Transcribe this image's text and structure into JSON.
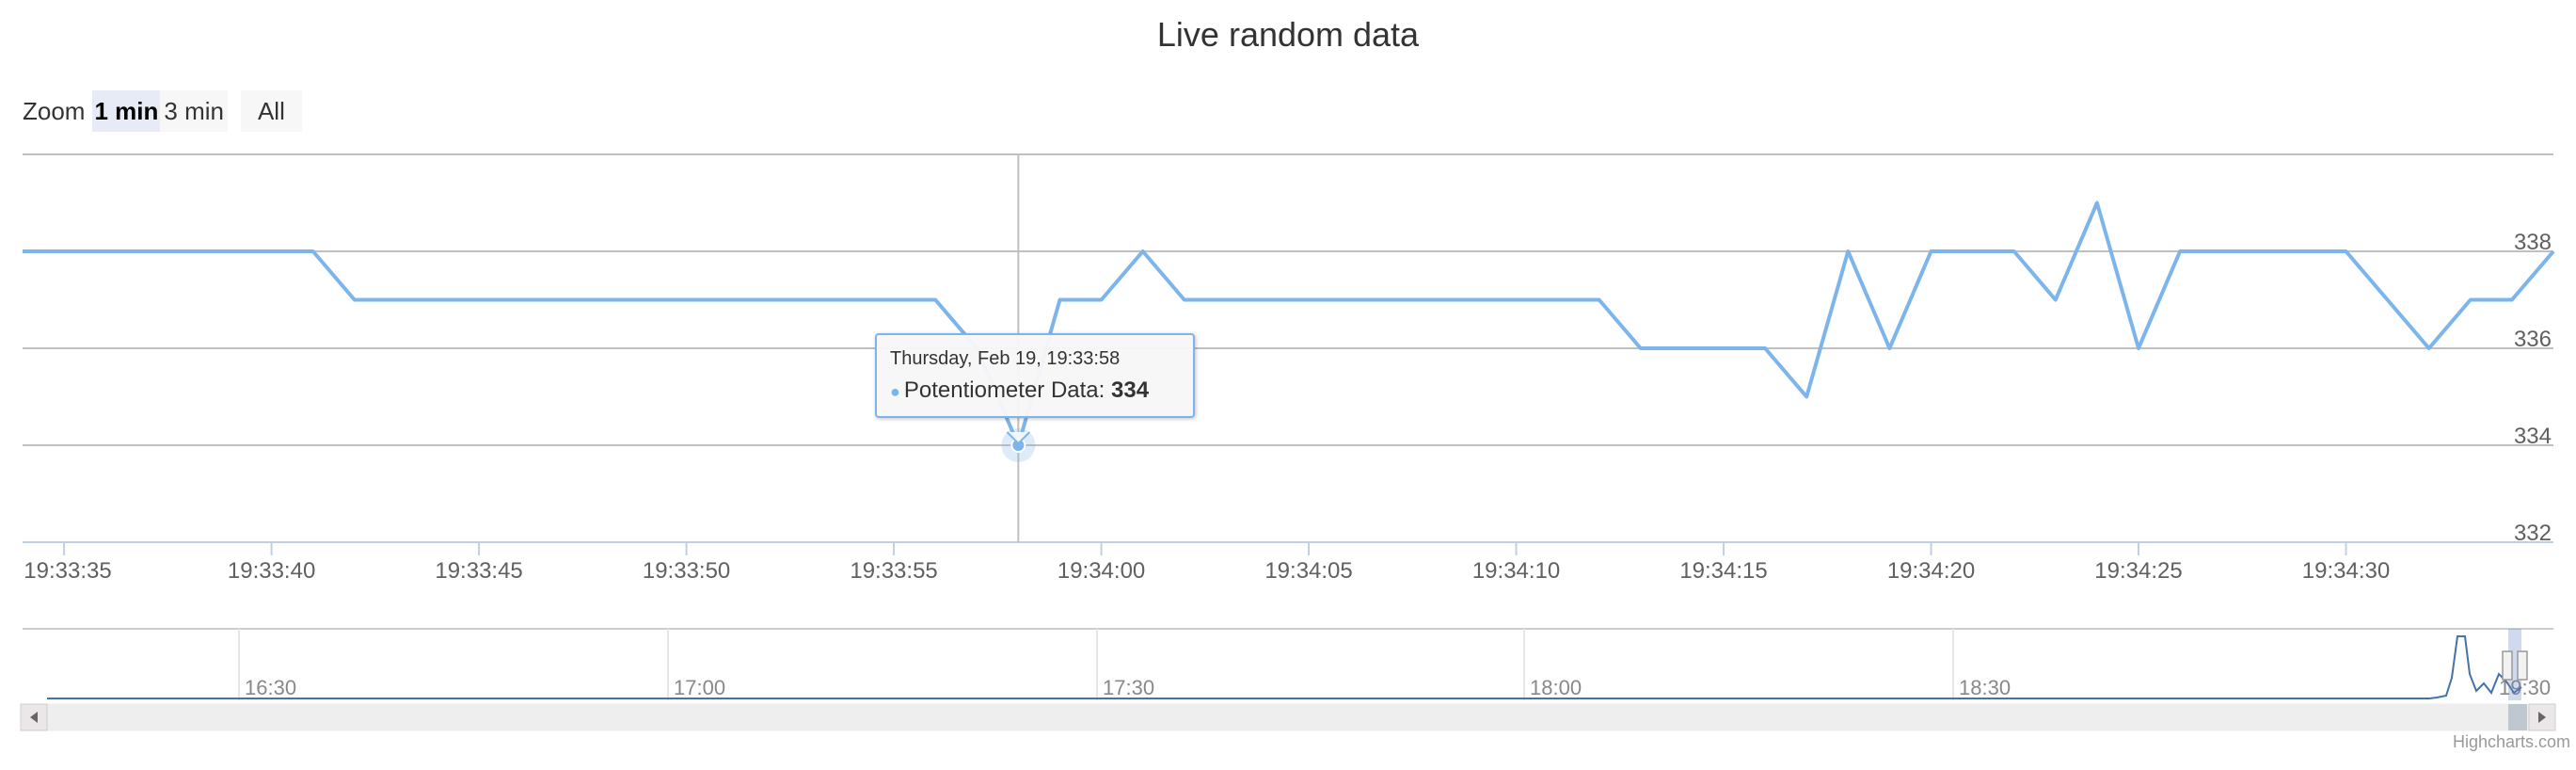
{
  "chart_data": {
    "type": "line",
    "title": "Live random data",
    "series": [
      {
        "name": "Potentiometer Data",
        "color": "#7cb5ec",
        "x": [
          "19:33:34",
          "19:33:35",
          "19:33:36",
          "19:33:37",
          "19:33:38",
          "19:33:39",
          "19:33:40",
          "19:33:41",
          "19:33:42",
          "19:33:43",
          "19:33:44",
          "19:33:45",
          "19:33:46",
          "19:33:47",
          "19:33:48",
          "19:33:49",
          "19:33:50",
          "19:33:51",
          "19:33:52",
          "19:33:53",
          "19:33:54",
          "19:33:55",
          "19:33:56",
          "19:33:57",
          "19:33:58",
          "19:33:59",
          "19:34:00",
          "19:34:01",
          "19:34:02",
          "19:34:03",
          "19:34:04",
          "19:34:05",
          "19:34:06",
          "19:34:07",
          "19:34:08",
          "19:34:09",
          "19:34:10",
          "19:34:11",
          "19:34:12",
          "19:34:13",
          "19:34:14",
          "19:34:15",
          "19:34:16",
          "19:34:17",
          "19:34:18",
          "19:34:19",
          "19:34:20",
          "19:34:21",
          "19:34:22",
          "19:34:23",
          "19:34:24",
          "19:34:25",
          "19:34:26",
          "19:34:27",
          "19:34:28",
          "19:34:29",
          "19:34:30",
          "19:34:31",
          "19:34:32",
          "19:34:33",
          "19:34:34",
          "19:34:35"
        ],
        "values": [
          338,
          338,
          338,
          338,
          338,
          338,
          338,
          338,
          337,
          337,
          337,
          337,
          337,
          337,
          337,
          337,
          337,
          337,
          337,
          337,
          337,
          337,
          337,
          336,
          334,
          337,
          337,
          338,
          337,
          337,
          337,
          337,
          337,
          337,
          337,
          337,
          337,
          337,
          337,
          336,
          336,
          336,
          336,
          335,
          338,
          336,
          338,
          338,
          338,
          337,
          339,
          336,
          338,
          338,
          338,
          338,
          338,
          337,
          336,
          337,
          337,
          338
        ]
      }
    ],
    "xlabel": "",
    "ylabel": "",
    "x_ticks": [
      "19:33:35",
      "19:33:40",
      "19:33:45",
      "19:33:50",
      "19:33:55",
      "19:34:00",
      "19:34:05",
      "19:34:10",
      "19:34:15",
      "19:34:20",
      "19:34:25",
      "19:34:30"
    ],
    "y_ticks": [
      332,
      334,
      336,
      338
    ],
    "ylim": [
      332,
      340
    ],
    "xlim": [
      "19:33:34",
      "19:34:35"
    ],
    "grid": true,
    "legend": false
  },
  "range_selector": {
    "label": "Zoom",
    "buttons": [
      "1 min",
      "3 min",
      "All"
    ],
    "active": "1 min"
  },
  "navigator": {
    "ticks": [
      "16:30",
      "17:00",
      "17:30",
      "18:00",
      "18:30",
      "19:30"
    ]
  },
  "tooltip": {
    "date": "Thursday, Feb 19, 19:33:58",
    "series_name": "Potentiometer Data",
    "separator": ": ",
    "value": "334",
    "x": "19:33:58",
    "y": 334
  },
  "credits": "Highcharts.com"
}
